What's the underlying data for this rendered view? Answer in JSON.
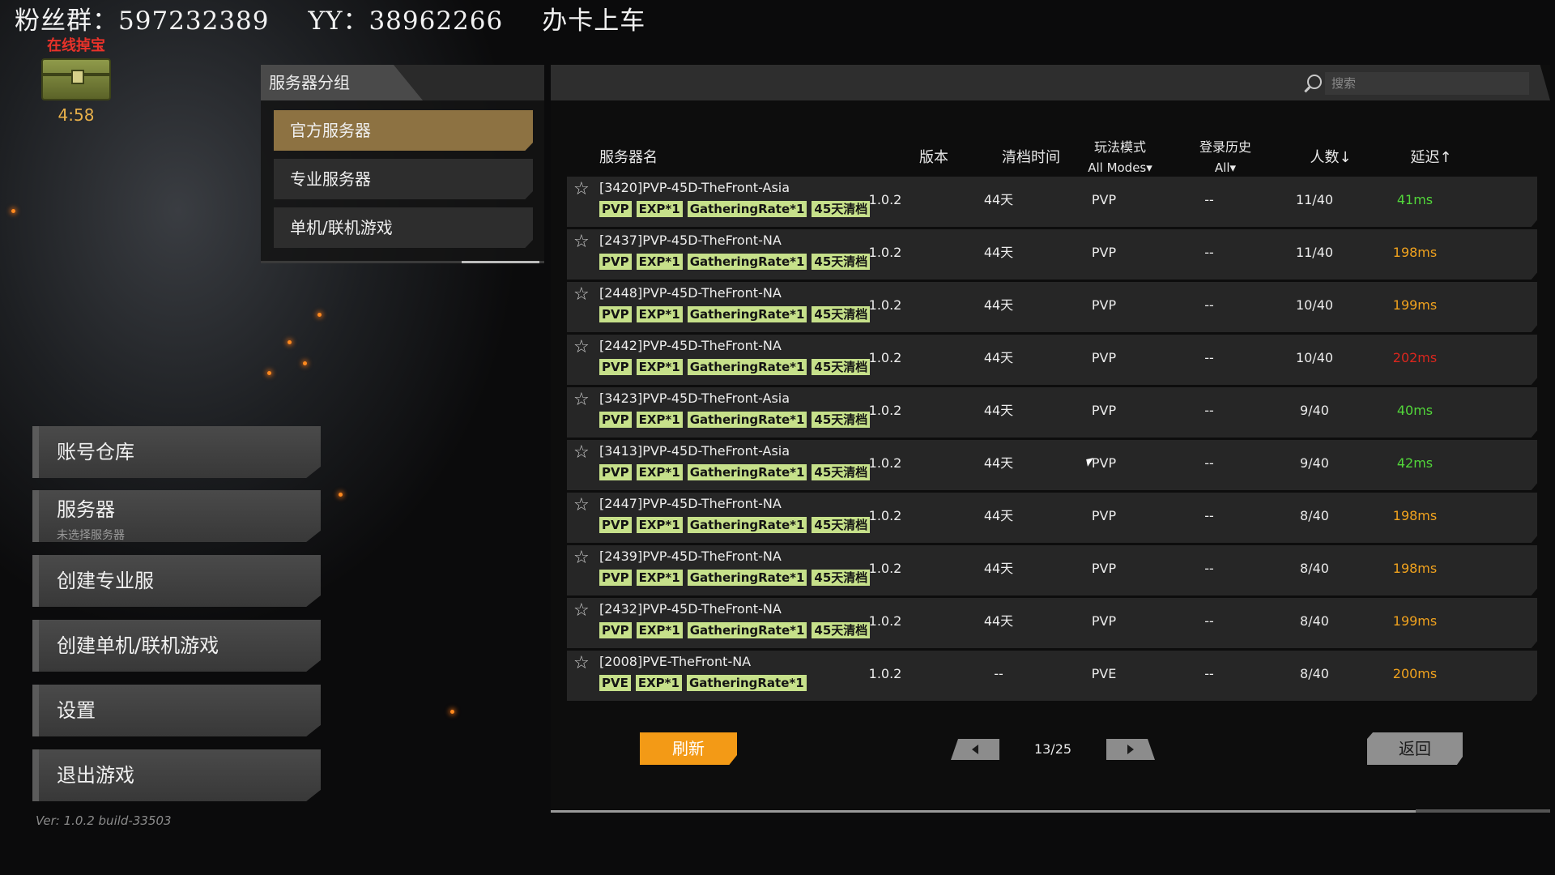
{
  "overlay": {
    "fans": "粉丝群：597232389",
    "yy": "YY：38962266",
    "promo": "办卡上车"
  },
  "treasure": {
    "title": "在线掉宝",
    "timer": "4:58",
    "icon": "treasure-chest-icon"
  },
  "menu": [
    {
      "label": "账号仓库"
    },
    {
      "label": "服务器",
      "sub": "未选择服务器"
    },
    {
      "label": "创建专业服"
    },
    {
      "label": "创建单机/联机游戏"
    },
    {
      "label": "设置"
    },
    {
      "label": "退出游戏"
    }
  ],
  "version": "Ver: 1.0.2 build-33503",
  "group_panel": {
    "title": "服务器分组",
    "items": [
      {
        "label": "官方服务器",
        "active": true
      },
      {
        "label": "专业服务器",
        "active": false
      },
      {
        "label": "单机/联机游戏",
        "active": false
      }
    ]
  },
  "search": {
    "placeholder": "搜索",
    "value": ""
  },
  "columns": {
    "name": "服务器名",
    "version": "版本",
    "wipe": "清档时间",
    "mode": "玩法模式",
    "mode_filter": "All Modes▾",
    "history": "登录历史",
    "history_filter": "All▾",
    "players": "人数↓",
    "ping": "延迟↑"
  },
  "servers": [
    {
      "name": "[3420]PVP-45D-TheFront-Asia",
      "tags": [
        "PVP",
        "EXP*1",
        "GatheringRate*1",
        "45天清档"
      ],
      "version": "1.0.2",
      "wipe": "44天",
      "mode": "PVP",
      "history": "--",
      "players": "11/40",
      "ping": "41ms",
      "ping_color": "#52d63a"
    },
    {
      "name": "[2437]PVP-45D-TheFront-NA",
      "tags": [
        "PVP",
        "EXP*1",
        "GatheringRate*1",
        "45天清档"
      ],
      "version": "1.0.2",
      "wipe": "44天",
      "mode": "PVP",
      "history": "--",
      "players": "11/40",
      "ping": "198ms",
      "ping_color": "#f0a21e"
    },
    {
      "name": "[2448]PVP-45D-TheFront-NA",
      "tags": [
        "PVP",
        "EXP*1",
        "GatheringRate*1",
        "45天清档"
      ],
      "version": "1.0.2",
      "wipe": "44天",
      "mode": "PVP",
      "history": "--",
      "players": "10/40",
      "ping": "199ms",
      "ping_color": "#f0a21e"
    },
    {
      "name": "[2442]PVP-45D-TheFront-NA",
      "tags": [
        "PVP",
        "EXP*1",
        "GatheringRate*1",
        "45天清档"
      ],
      "version": "1.0.2",
      "wipe": "44天",
      "mode": "PVP",
      "history": "--",
      "players": "10/40",
      "ping": "202ms",
      "ping_color": "#d9261e"
    },
    {
      "name": "[3423]PVP-45D-TheFront-Asia",
      "tags": [
        "PVP",
        "EXP*1",
        "GatheringRate*1",
        "45天清档"
      ],
      "version": "1.0.2",
      "wipe": "44天",
      "mode": "PVP",
      "history": "--",
      "players": "9/40",
      "ping": "40ms",
      "ping_color": "#52d63a"
    },
    {
      "name": "[3413]PVP-45D-TheFront-Asia",
      "tags": [
        "PVP",
        "EXP*1",
        "GatheringRate*1",
        "45天清档"
      ],
      "version": "1.0.2",
      "wipe": "44天",
      "mode": "PVP",
      "history": "--",
      "players": "9/40",
      "ping": "42ms",
      "ping_color": "#52d63a"
    },
    {
      "name": "[2447]PVP-45D-TheFront-NA",
      "tags": [
        "PVP",
        "EXP*1",
        "GatheringRate*1",
        "45天清档"
      ],
      "version": "1.0.2",
      "wipe": "44天",
      "mode": "PVP",
      "history": "--",
      "players": "8/40",
      "ping": "198ms",
      "ping_color": "#f0a21e"
    },
    {
      "name": "[2439]PVP-45D-TheFront-NA",
      "tags": [
        "PVP",
        "EXP*1",
        "GatheringRate*1",
        "45天清档"
      ],
      "version": "1.0.2",
      "wipe": "44天",
      "mode": "PVP",
      "history": "--",
      "players": "8/40",
      "ping": "198ms",
      "ping_color": "#f0a21e"
    },
    {
      "name": "[2432]PVP-45D-TheFront-NA",
      "tags": [
        "PVP",
        "EXP*1",
        "GatheringRate*1",
        "45天清档"
      ],
      "version": "1.0.2",
      "wipe": "44天",
      "mode": "PVP",
      "history": "--",
      "players": "8/40",
      "ping": "199ms",
      "ping_color": "#f0a21e"
    },
    {
      "name": "[2008]PVE-TheFront-NA",
      "tags": [
        "PVE",
        "EXP*1",
        "GatheringRate*1"
      ],
      "version": "1.0.2",
      "wipe": "--",
      "mode": "PVE",
      "history": "--",
      "players": "8/40",
      "ping": "200ms",
      "ping_color": "#f0a21e"
    }
  ],
  "footer": {
    "refresh": "刷新",
    "page": "13/25",
    "back": "返回"
  }
}
